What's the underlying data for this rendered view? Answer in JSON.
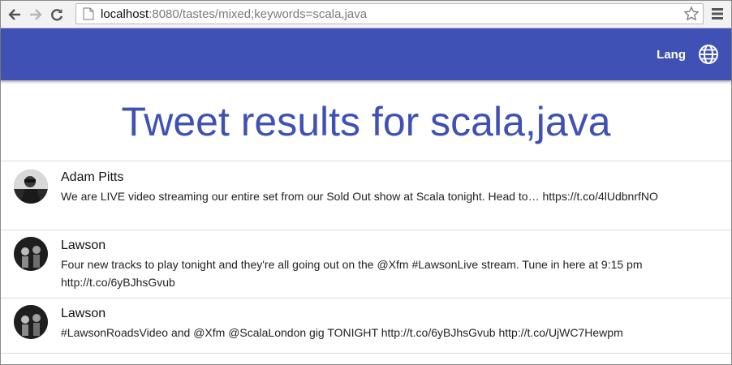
{
  "browser": {
    "url_host": "localhost",
    "url_rest": ":8080/tastes/mixed;keywords=scala,java"
  },
  "appbar": {
    "lang_label": "Lang",
    "color": "#3f51b5"
  },
  "page_title": "Tweet results for scala,java",
  "tweets": [
    {
      "author": "Adam Pitts",
      "text": "We are LIVE video streaming our entire set from our Sold Out show at Scala tonight. Head to… https://t.co/4lUdbnrfNO"
    },
    {
      "author": "Lawson",
      "text": "Four new tracks to play tonight and they're all going out on the @Xfm #LawsonLive stream. Tune in here at 9:15 pm http://t.co/6yBJhsGvub"
    },
    {
      "author": "Lawson",
      "text": "#LawsonRoadsVideo and @Xfm @ScalaLondon gig TONIGHT http://t.co/6yBJhsGvub http://t.co/UjWC7Hewpm"
    }
  ]
}
